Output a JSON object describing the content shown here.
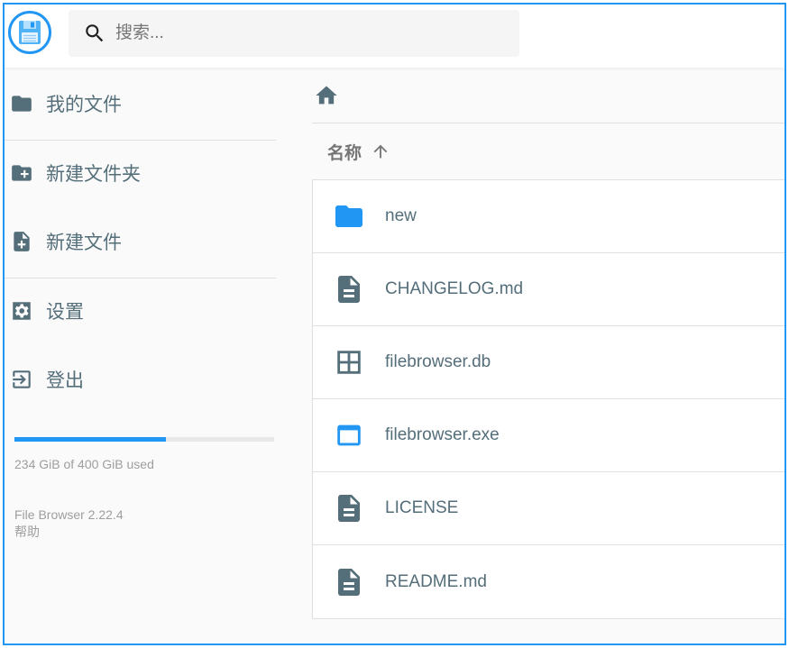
{
  "header": {
    "logo_icon": "floppy-disk-icon",
    "search_placeholder": "搜索..."
  },
  "sidebar": {
    "items": [
      {
        "label": "我的文件",
        "icon": "folder-icon"
      },
      {
        "label": "新建文件夹",
        "icon": "create-folder-icon"
      },
      {
        "label": "新建文件",
        "icon": "note-add-icon"
      },
      {
        "label": "设置",
        "icon": "settings-icon"
      },
      {
        "label": "登出",
        "icon": "exit-icon"
      }
    ],
    "usage": {
      "text": "234 GiB of 400 GiB used",
      "fraction": 0.585
    },
    "version": "File Browser 2.22.4",
    "help": "帮助"
  },
  "main": {
    "breadcrumb_icon": "home-icon",
    "column_name": "名称",
    "sort_icon": "arrow-up-icon",
    "files": [
      {
        "name": "new",
        "icon": "folder-icon",
        "color": "#2196f3"
      },
      {
        "name": "CHANGELOG.md",
        "icon": "description-icon",
        "color": "#546e7a"
      },
      {
        "name": "filebrowser.db",
        "icon": "grid-icon",
        "color": "#546e7a"
      },
      {
        "name": "filebrowser.exe",
        "icon": "application-icon",
        "color": "#2196f3"
      },
      {
        "name": "LICENSE",
        "icon": "description-icon",
        "color": "#546e7a"
      },
      {
        "name": "README.md",
        "icon": "description-icon",
        "color": "#546e7a"
      }
    ]
  },
  "colors": {
    "accent": "#2196f3",
    "text": "#546e7a",
    "muted": "#9e9e9e"
  }
}
